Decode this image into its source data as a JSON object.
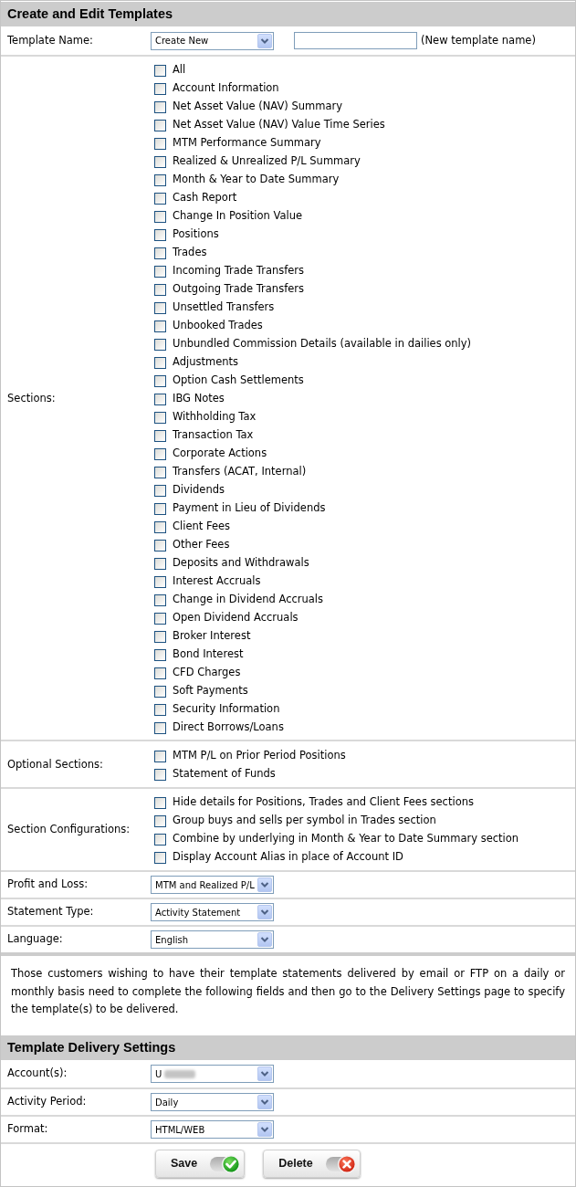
{
  "panel": {
    "title": "Create and Edit Templates"
  },
  "template_name": {
    "label": "Template Name:",
    "value": "Create New",
    "hint": "(New template name)"
  },
  "checklists": [
    {
      "label": "Sections:",
      "items": [
        {
          "label": "All",
          "checked": false
        },
        {
          "label": "Account Information",
          "checked": false
        },
        {
          "label": "Net Asset Value (NAV) Summary",
          "checked": false
        },
        {
          "label": "Net Asset Value (NAV) Value Time Series",
          "checked": false
        },
        {
          "label": "MTM Performance Summary",
          "checked": false
        },
        {
          "label": "Realized & Unrealized P/L Summary",
          "checked": false
        },
        {
          "label": "Month & Year to Date Summary",
          "checked": false
        },
        {
          "label": "Cash Report",
          "checked": false
        },
        {
          "label": "Change In Position Value",
          "checked": false
        },
        {
          "label": "Positions",
          "checked": false
        },
        {
          "label": "Trades",
          "checked": false
        },
        {
          "label": "Incoming Trade Transfers",
          "checked": false
        },
        {
          "label": "Outgoing Trade Transfers",
          "checked": false
        },
        {
          "label": "Unsettled Transfers",
          "checked": false
        },
        {
          "label": "Unbooked Trades",
          "checked": false
        },
        {
          "label": "Unbundled Commission Details (available in dailies only)",
          "checked": false
        },
        {
          "label": "Adjustments",
          "checked": false
        },
        {
          "label": "Option Cash Settlements",
          "checked": false
        },
        {
          "label": "IBG Notes",
          "checked": false
        },
        {
          "label": "Withholding Tax",
          "checked": false
        },
        {
          "label": "Transaction Tax",
          "checked": false
        },
        {
          "label": "Corporate Actions",
          "checked": false
        },
        {
          "label": "Transfers (ACAT, Internal)",
          "checked": false
        },
        {
          "label": "Dividends",
          "checked": false
        },
        {
          "label": "Payment in Lieu of Dividends",
          "checked": false
        },
        {
          "label": "Client Fees",
          "checked": false
        },
        {
          "label": "Other Fees",
          "checked": false
        },
        {
          "label": "Deposits and Withdrawals",
          "checked": false
        },
        {
          "label": "Interest Accruals",
          "checked": false
        },
        {
          "label": "Change in Dividend Accruals",
          "checked": false
        },
        {
          "label": "Open Dividend Accruals",
          "checked": false
        },
        {
          "label": "Broker Interest",
          "checked": false
        },
        {
          "label": "Bond Interest",
          "checked": false
        },
        {
          "label": "CFD Charges",
          "checked": false
        },
        {
          "label": "Soft Payments",
          "checked": false
        },
        {
          "label": "Security Information",
          "checked": false
        },
        {
          "label": "Direct Borrows/Loans",
          "checked": false
        }
      ]
    },
    {
      "label": "Optional Sections:",
      "items": [
        {
          "label": "MTM P/L on Prior Period Positions",
          "checked": false
        },
        {
          "label": "Statement of Funds",
          "checked": false
        }
      ]
    },
    {
      "label": "Section Configurations:",
      "items": [
        {
          "label": "Hide details for Positions, Trades and Client Fees sections",
          "checked": false
        },
        {
          "label": "Group buys and sells per symbol in Trades section",
          "checked": false
        },
        {
          "label": "Combine by underlying in Month & Year to Date Summary section",
          "checked": false
        },
        {
          "label": "Display Account Alias in place of Account ID",
          "checked": false
        }
      ]
    }
  ],
  "dropdowns": [
    {
      "label": "Profit and Loss:",
      "value": "MTM and Realized P/L"
    },
    {
      "label": "Statement Type:",
      "value": "Activity Statement"
    },
    {
      "label": "Language:",
      "value": "English"
    }
  ],
  "note": "Those customers wishing to have their template statements delivered by email or FTP on a daily or monthly basis need to complete the following fields and then go to the Delivery Settings page to specify the template(s) to be delivered.",
  "delivery": {
    "title": "Template Delivery Settings",
    "dropdowns": [
      {
        "label": "Account(s):",
        "value": "U",
        "redacted": true
      },
      {
        "label": "Activity Period:",
        "value": "Daily",
        "redacted": false
      },
      {
        "label": "Format:",
        "value": "HTML/WEB",
        "redacted": false
      }
    ]
  },
  "buttons": [
    {
      "label": "Save",
      "kind": "save"
    },
    {
      "label": "Delete",
      "kind": "delete"
    }
  ]
}
